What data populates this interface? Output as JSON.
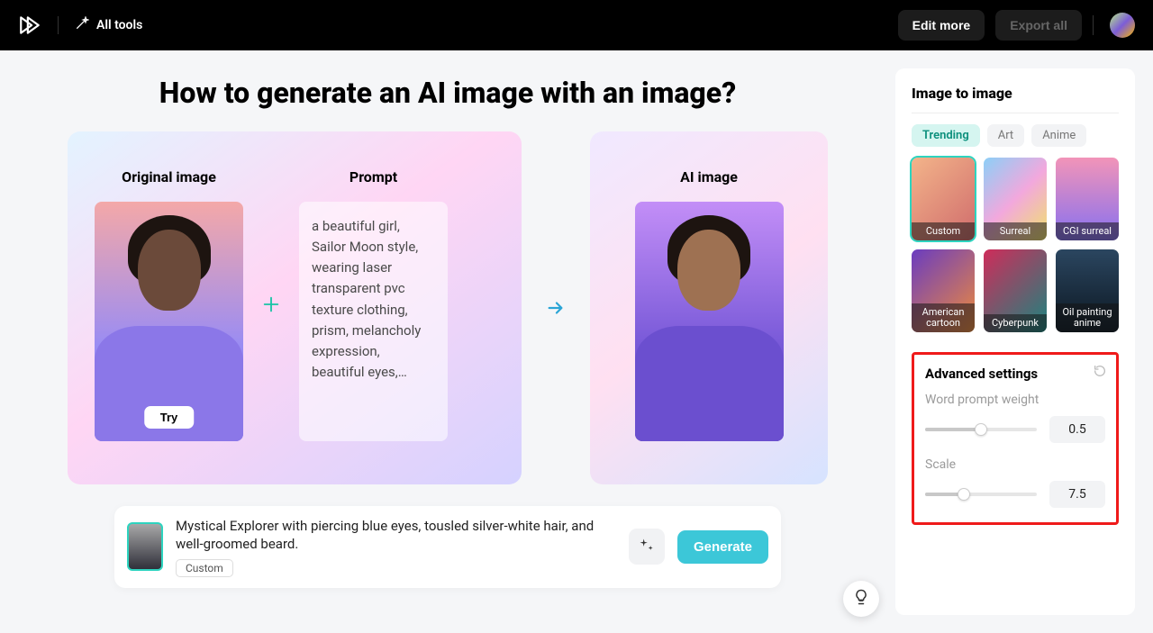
{
  "header": {
    "all_tools": "All tools",
    "edit_more": "Edit more",
    "export_all": "Export all"
  },
  "page_title": "How to generate an AI image with an image?",
  "example": {
    "original_label": "Original image",
    "prompt_label": "Prompt",
    "ai_label": "AI image",
    "prompt_text": "a beautiful girl, Sailor Moon style, wearing laser transparent pvc texture clothing, prism, melancholy expression, beautiful eyes,…",
    "try_label": "Try"
  },
  "prompt_bar": {
    "text": "Mystical Explorer with piercing blue eyes, tousled silver-white hair, and well-groomed beard.",
    "chip": "Custom",
    "generate": "Generate"
  },
  "side": {
    "title": "Image to image",
    "tabs": [
      "Trending",
      "Art",
      "Anime"
    ],
    "active_tab": 0,
    "styles": [
      {
        "label": "Custom"
      },
      {
        "label": "Surreal"
      },
      {
        "label": "CGI surreal"
      },
      {
        "label": "American cartoon"
      },
      {
        "label": "Cyberpunk"
      },
      {
        "label": "Oil painting anime"
      }
    ],
    "selected_style": 0,
    "advanced": {
      "title": "Advanced settings",
      "word_weight_label": "Word prompt weight",
      "word_weight_value": "0.5",
      "word_weight_pct": 50,
      "scale_label": "Scale",
      "scale_value": "7.5",
      "scale_pct": 35
    }
  }
}
